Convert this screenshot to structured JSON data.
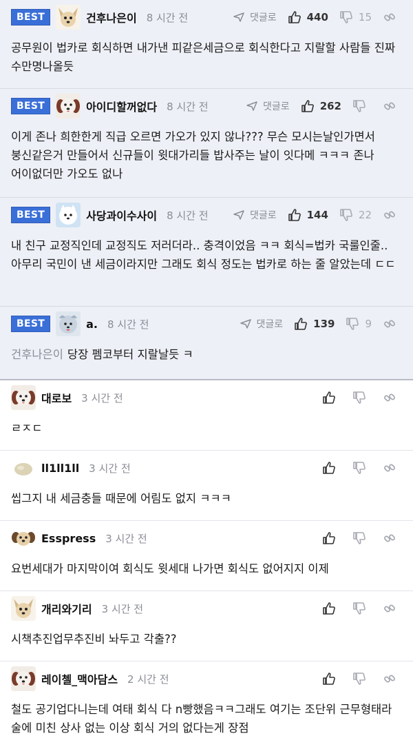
{
  "best_label": "BEST",
  "reply_label": "댓글로",
  "comments": [
    {
      "best": true,
      "avatar": "dog-avatar-1",
      "nickname": "건후나은이",
      "time": "8 시간 전",
      "likes": "440",
      "dislikes": "15",
      "mention": "",
      "text": "공무원이 법카로 회식하면 내가낸 피같은세금으로 회식한다고 지랄할 사람들 진짜 수만명나올듯"
    },
    {
      "best": true,
      "avatar": "dog-avatar-2",
      "nickname": "아이디할꺼없다",
      "time": "8 시간 전",
      "likes": "262",
      "dislikes": "",
      "mention": "",
      "text": "이게 존나 희한한게 직급 오르면 가오가 있지 않나??? 무슨 모시는날인가면서 붕신같은거 만들어서 신규들이 윗대가리들 밥사주는 날이 잇다메 ㅋㅋㅋ 존나 어이없더만 가오도 없나"
    },
    {
      "best": true,
      "avatar": "dog-avatar-3",
      "nickname": "사당과이수사이",
      "time": "8 시간 전",
      "likes": "144",
      "dislikes": "22",
      "mention": "",
      "text": "내 친구 교정직인데 교정직도 저러더라.. 충격이었음 ㅋㅋ 회식=법카 국룰인줄.. 아무리 국민이 낸 세금이라지만 그래도 회식 정도는 법카로 하는 줄 알았는데 ㄷㄷ"
    },
    {
      "best": true,
      "avatar": "dog-avatar-4",
      "nickname": "a.",
      "time": "8 시간 전",
      "likes": "139",
      "dislikes": "9",
      "mention": "건후나은이",
      "text": "당장 펨코부터 지랄날듯 ㅋ"
    },
    {
      "best": false,
      "avatar": "dog-avatar-2",
      "nickname": "대로보",
      "time": "3 시간 전",
      "likes": "",
      "dislikes": "",
      "mention": "",
      "text": "ㄹㅈㄷ"
    },
    {
      "best": false,
      "avatar": "dog-avatar-5",
      "nickname": "ll1ll1ll",
      "time": "3 시간 전",
      "likes": "",
      "dislikes": "",
      "mention": "",
      "text": "씹그지 내 세금충들 때문에 어림도 없지 ㅋㅋㅋ"
    },
    {
      "best": false,
      "avatar": "dog-avatar-6",
      "nickname": "Esspress",
      "time": "3 시간 전",
      "likes": "",
      "dislikes": "",
      "mention": "",
      "text": "요번세대가 마지막이여 회식도 윗세대 나가면 회식도 없어지지 이제"
    },
    {
      "best": false,
      "avatar": "dog-avatar-1",
      "nickname": "개리와기리",
      "time": "3 시간 전",
      "likes": "",
      "dislikes": "",
      "mention": "",
      "text": "시책추진업무추진비 놔두고 각출??"
    },
    {
      "best": false,
      "avatar": "dog-avatar-2",
      "nickname": "레이첼_맥아담스",
      "time": "2 시간 전",
      "likes": "",
      "dislikes": "",
      "mention": "",
      "text": "철도 공기업다니는데 여태 회식 다 n빵했음ㅋㅋ그래도 여기는 조단위 근무형태라 술에 미친 상사 없는 이상 회식 거의 없다는게 장점"
    }
  ]
}
